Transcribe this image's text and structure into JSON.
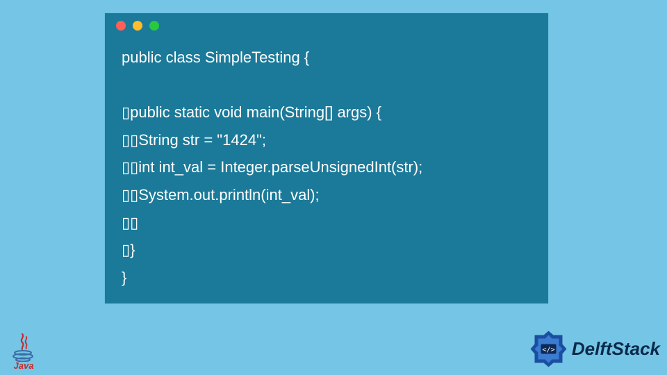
{
  "window": {
    "dots": [
      "red",
      "yellow",
      "green"
    ]
  },
  "code": {
    "line1": "public class SimpleTesting {",
    "line2": "",
    "line3": "▯public static void main(String[] args) {",
    "line4": "▯▯String str = \"1424\";",
    "line5": "▯▯int int_val = Integer.parseUnsignedInt(str);",
    "line6": "▯▯System.out.println(int_val);",
    "line7": "▯▯",
    "line8": "▯}",
    "line9": "}"
  },
  "footer": {
    "java_label": "Java",
    "brand": "DelftStack"
  }
}
